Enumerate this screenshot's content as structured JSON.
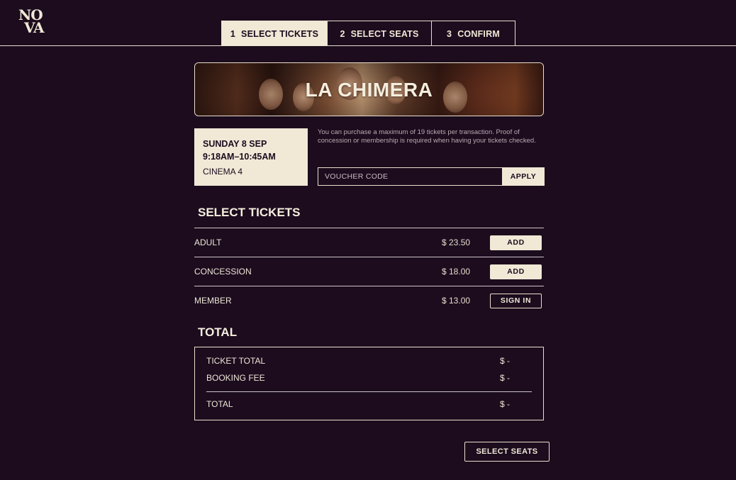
{
  "brand": {
    "logo_line1": "NO",
    "logo_line2": "VA"
  },
  "steps": [
    {
      "num": "1",
      "label": "SELECT TICKETS",
      "active": true
    },
    {
      "num": "2",
      "label": "SELECT SEATS",
      "active": false
    },
    {
      "num": "3",
      "label": "CONFIRM",
      "active": false
    }
  ],
  "film": {
    "title": "LA CHIMERA"
  },
  "session": {
    "date": "SUNDAY 8 SEP",
    "time": "9:18AM–10:45AM",
    "cinema": "CINEMA 4"
  },
  "notice": "You can purchase a maximum of 19 tickets per transaction. Proof of concession or membership is required when having your tickets checked.",
  "voucher": {
    "placeholder": "VOUCHER CODE",
    "apply_label": "APPLY"
  },
  "tickets": {
    "title": "SELECT TICKETS",
    "rows": [
      {
        "name": "ADULT",
        "price": "$ 23.50",
        "action": "ADD"
      },
      {
        "name": "CONCESSION",
        "price": "$ 18.00",
        "action": "ADD"
      },
      {
        "name": "MEMBER",
        "price": "$ 13.00",
        "action": "SIGN IN"
      }
    ]
  },
  "total": {
    "title": "TOTAL",
    "ticket_total_label": "TICKET TOTAL",
    "ticket_total_value": "$ -",
    "booking_fee_label": "BOOKING FEE",
    "booking_fee_value": "$ -",
    "total_label": "TOTAL",
    "total_value": "$ -"
  },
  "cta": {
    "label": "SELECT SEATS"
  },
  "colors": {
    "background": "#1c0c1e",
    "cream": "#f1e8d6"
  }
}
